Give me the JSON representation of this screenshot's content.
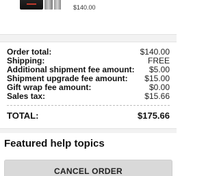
{
  "product": {
    "price": "$140.00",
    "thumbnail_icon": "game-console-product-image"
  },
  "summary": {
    "rows": [
      {
        "label": "Order total:",
        "value": "$140.00"
      },
      {
        "label": "Shipping:",
        "value": "FREE"
      },
      {
        "label": "Additional shipment fee amount:",
        "value": "$5.00"
      },
      {
        "label": "Shipment upgrade fee amount:",
        "value": "$15.00"
      },
      {
        "label": "Gift wrap fee amount:",
        "value": "$0.00"
      },
      {
        "label": "Sales tax:",
        "value": "$15.66"
      }
    ],
    "total_label": "TOTAL:",
    "total_value": "$175.66"
  },
  "help": {
    "heading": "Featured help topics"
  },
  "actions": {
    "cancel_label": "CANCEL ORDER"
  }
}
